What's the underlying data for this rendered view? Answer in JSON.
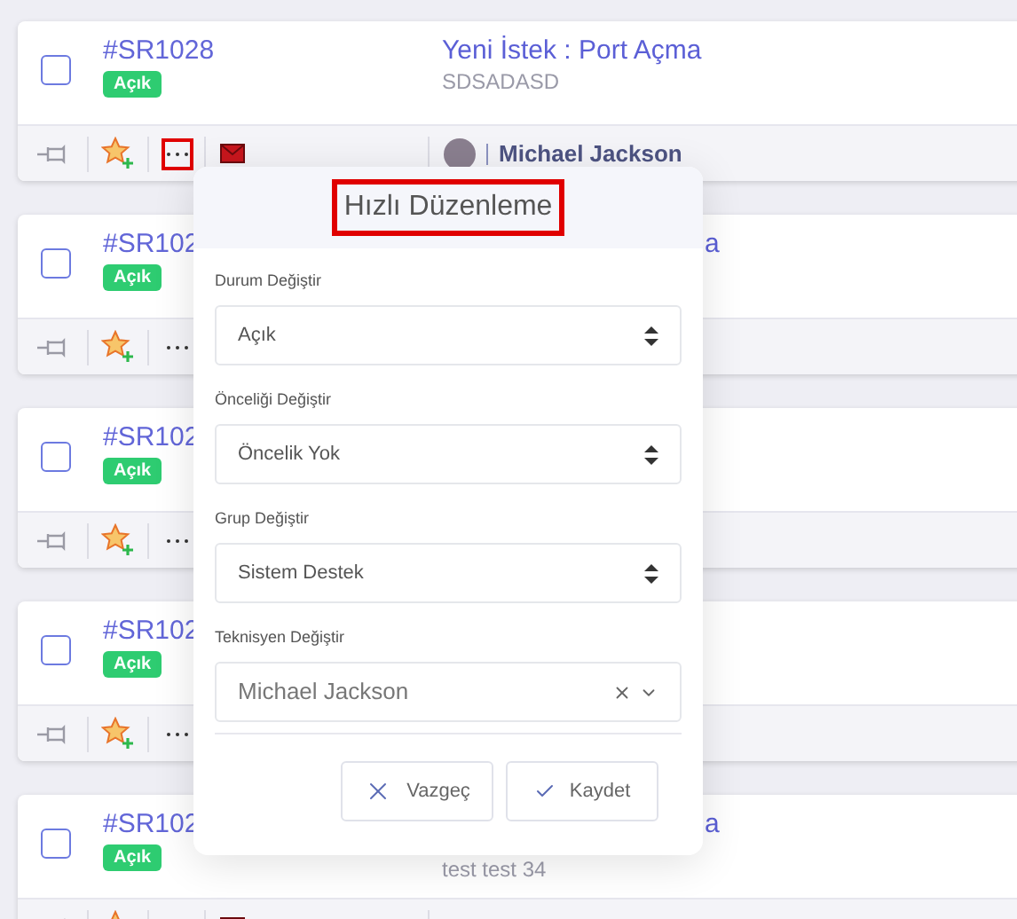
{
  "tickets": [
    {
      "id": "#SR1028",
      "checked": false,
      "status": "Açık",
      "title": "Yeni İstek : Port Açma",
      "subtitle": "SDSADASD",
      "title_covered": false,
      "menu_highlighted": true,
      "mail": true,
      "assignee": "Michael Jackson"
    },
    {
      "id": "#SR102",
      "checked": false,
      "status": "Açık",
      "title": "a",
      "title_covered": true,
      "menu_highlighted": false
    },
    {
      "id": "#SR102",
      "checked": false,
      "status": "Açık",
      "menu_highlighted": false
    },
    {
      "id": "#SR102",
      "checked": false,
      "status": "Açık",
      "menu_highlighted": false
    },
    {
      "id": "#SR102",
      "checked": false,
      "status": "Açık",
      "title": "a",
      "subtitle": "test test 34",
      "title_covered": true,
      "mail": true
    }
  ],
  "quick_edit": {
    "title": "Hızlı Düzenleme",
    "title_highlighted": true,
    "fields": [
      {
        "label": "Durum Değiştir",
        "value": "Açık",
        "kind": "select"
      },
      {
        "label": "Önceliği Değiştir",
        "value": "Öncelik Yok",
        "kind": "select"
      },
      {
        "label": "Grup Değiştir",
        "value": "Sistem Destek",
        "kind": "select"
      },
      {
        "label": "Teknisyen Değiştir",
        "value": "Michael Jackson",
        "kind": "combo"
      }
    ],
    "buttons": [
      {
        "label": "Vazgeç",
        "kind": "cancel"
      },
      {
        "label": "Kaydet",
        "kind": "save"
      }
    ]
  }
}
